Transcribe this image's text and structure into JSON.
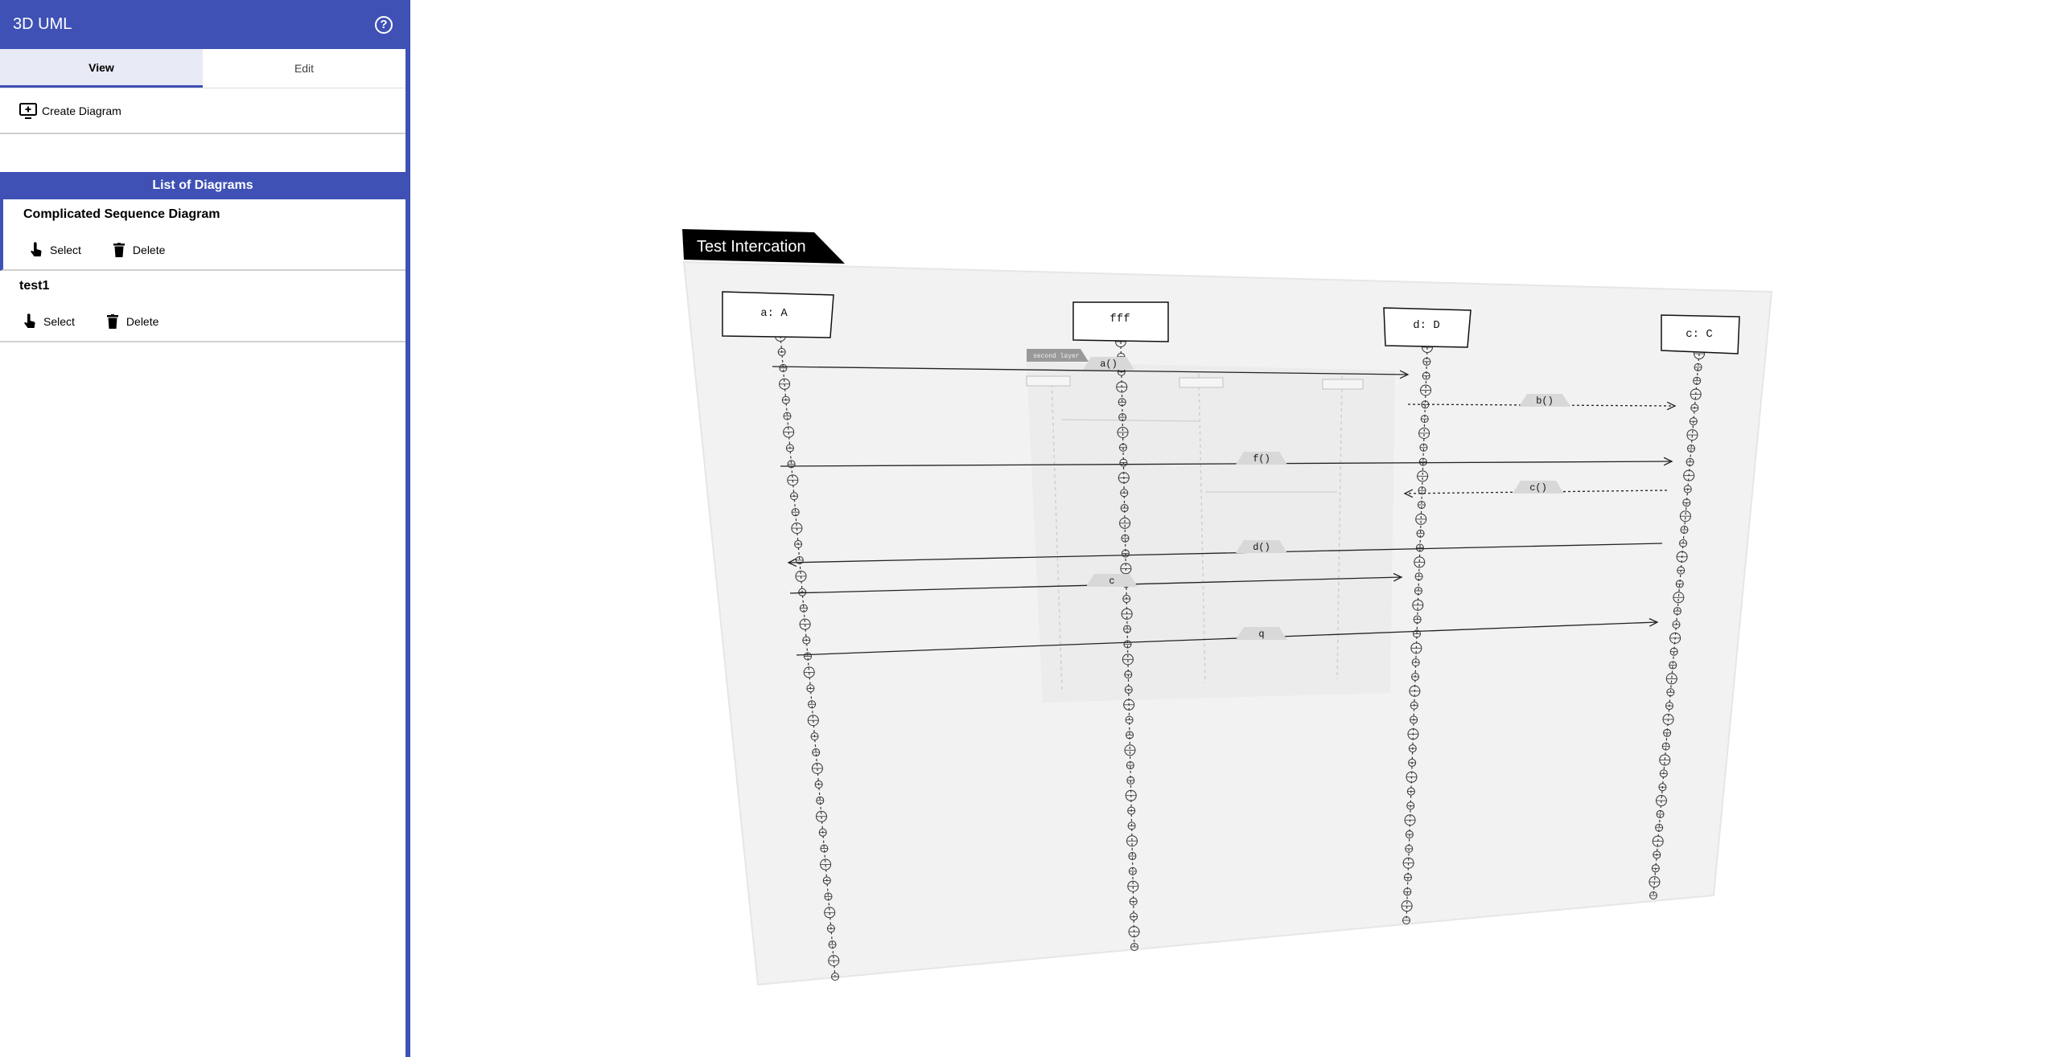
{
  "app": {
    "title": "3D UML",
    "help_icon": "help-circle-icon"
  },
  "tabs": [
    {
      "label": "View",
      "active": true
    },
    {
      "label": "Edit",
      "active": false
    }
  ],
  "actions": {
    "create_label": "Create Diagram",
    "create_icon": "add-to-screen-icon"
  },
  "list": {
    "header": "List of Diagrams",
    "items": [
      {
        "name": "Complicated Sequence Diagram",
        "select_label": "Select",
        "delete_label": "Delete",
        "selected": true
      },
      {
        "name": "test1",
        "select_label": "Select",
        "delete_label": "Delete",
        "selected": false
      }
    ]
  },
  "diagram": {
    "title": "Test Intercation",
    "lifelines": [
      "a: A",
      "fff",
      "d: D",
      "c: C"
    ],
    "messages": [
      "a()",
      "b()",
      "f()",
      "c()",
      "d()",
      "c",
      "q"
    ],
    "subframe_label": "second layer"
  },
  "colors": {
    "accent": "#3f51b5",
    "sidebar_bg": "#ffffff",
    "selected_tab": "#e8eaf6"
  }
}
